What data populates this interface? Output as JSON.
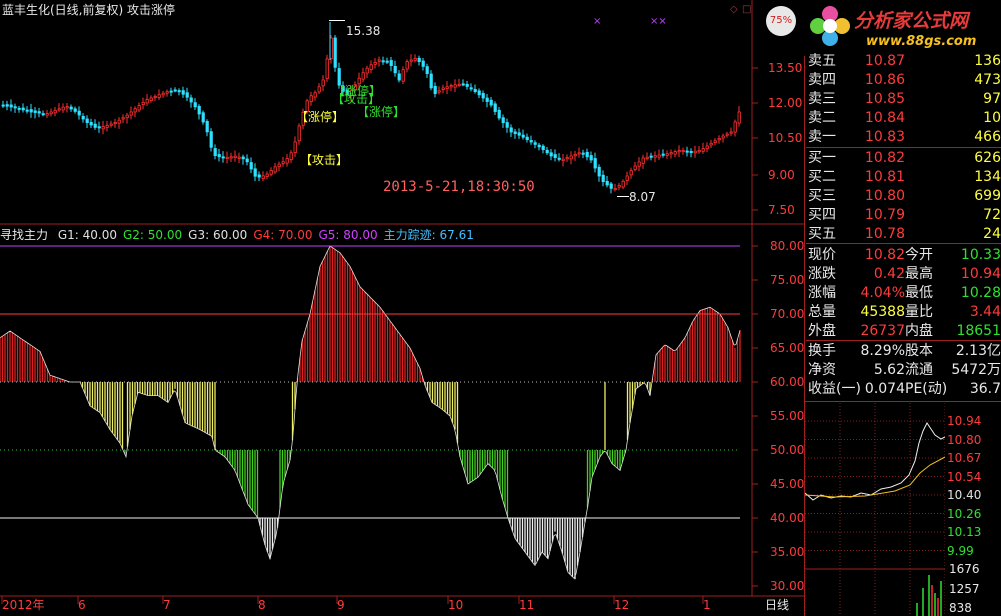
{
  "title": {
    "stock": "蓝丰生化(日线,前复权)",
    "indicator": "攻击涨停"
  },
  "logo": {
    "percent": "75%",
    "brand": "分析家公式网",
    "url": "www.88gs.com"
  },
  "upper_chart": {
    "y_ticks": [
      "13.50",
      "12.00",
      "10.50",
      "9.00",
      "7.50"
    ],
    "high_label": "15.38",
    "low_label": "8.07",
    "timestamp": "2013-5-21,18:30:50",
    "signals": [
      {
        "text": "攻击",
        "color": "#ffff40"
      },
      {
        "text": "涨停",
        "color": "#ffff40"
      },
      {
        "text": "涨停",
        "color": "#30e030"
      },
      {
        "text": "涨停",
        "color": "#30e030"
      },
      {
        "text": "攻击",
        "color": "#30e030"
      }
    ]
  },
  "indicator": {
    "name": "寻找主力",
    "items": [
      {
        "text": "G1: 40.00",
        "color": "#e0e0e0"
      },
      {
        "text": "G2: 50.00",
        "color": "#30e030"
      },
      {
        "text": "G3: 60.00",
        "color": "#e0e0e0"
      },
      {
        "text": "G4: 70.00",
        "color": "#ff3b3b"
      },
      {
        "text": "G5: 80.00",
        "color": "#d040ff"
      },
      {
        "text": "主力踪迹: 67.61",
        "color": "#40c0ff"
      }
    ],
    "y_ticks": [
      "80.00",
      "75.00",
      "70.00",
      "65.00",
      "60.00",
      "55.00",
      "50.00",
      "45.00",
      "40.00",
      "35.00",
      "30.00"
    ],
    "levels": [
      40,
      50,
      60,
      70,
      80
    ]
  },
  "x_axis": {
    "labels": [
      "2012年",
      "6",
      "7",
      "8",
      "9",
      "10",
      "11",
      "12",
      "1"
    ],
    "period": "日线"
  },
  "quotes": {
    "sell": [
      {
        "label": "卖五",
        "price": "10.87",
        "vol": "136"
      },
      {
        "label": "卖四",
        "price": "10.86",
        "vol": "473"
      },
      {
        "label": "卖三",
        "price": "10.85",
        "vol": "97"
      },
      {
        "label": "卖二",
        "price": "10.84",
        "vol": "10"
      },
      {
        "label": "卖一",
        "price": "10.83",
        "vol": "466"
      }
    ],
    "buy": [
      {
        "label": "买一",
        "price": "10.82",
        "vol": "626"
      },
      {
        "label": "买二",
        "price": "10.81",
        "vol": "134"
      },
      {
        "label": "买三",
        "price": "10.80",
        "vol": "699"
      },
      {
        "label": "买四",
        "price": "10.79",
        "vol": "72"
      },
      {
        "label": "买五",
        "price": "10.78",
        "vol": "24"
      }
    ],
    "stats": [
      {
        "l1": "现价",
        "v1": "10.82",
        "c1": "red",
        "l2": "今开",
        "v2": "10.33",
        "c2": "grn"
      },
      {
        "l1": "涨跌",
        "v1": "0.42",
        "c1": "red",
        "l2": "最高",
        "v2": "10.94",
        "c2": "red"
      },
      {
        "l1": "涨幅",
        "v1": "4.04%",
        "c1": "red",
        "l2": "最低",
        "v2": "10.28",
        "c2": "grn"
      },
      {
        "l1": "总量",
        "v1": "45388",
        "c1": "yel",
        "l2": "量比",
        "v2": "3.44",
        "c2": "red"
      },
      {
        "l1": "外盘",
        "v1": "26737",
        "c1": "red",
        "l2": "内盘",
        "v2": "18651",
        "c2": "grn"
      }
    ],
    "stats2": [
      {
        "l1": "换手",
        "v1": "8.29%",
        "l2": "股本",
        "v2": "2.13亿"
      },
      {
        "l1": "净资",
        "v1": "5.62",
        "l2": "流通",
        "v2": "5472万"
      },
      {
        "l1": "收益(一)",
        "v1": "0.074",
        "l2": "PE(动)",
        "v2": "36.7"
      }
    ]
  },
  "mini_chart": {
    "price_ticks": [
      {
        "v": "10.94",
        "color": "#ff3b3b"
      },
      {
        "v": "10.80",
        "color": "#ff3b3b"
      },
      {
        "v": "10.67",
        "color": "#ff3b3b"
      },
      {
        "v": "10.54",
        "color": "#ff3b3b"
      },
      {
        "v": "10.40",
        "color": "#e0e0e0"
      },
      {
        "v": "10.26",
        "color": "#30e030"
      },
      {
        "v": "10.13",
        "color": "#30e030"
      },
      {
        "v": "9.99",
        "color": "#30e030"
      }
    ],
    "vol_ticks": [
      "1676",
      "1257",
      "838"
    ]
  }
}
